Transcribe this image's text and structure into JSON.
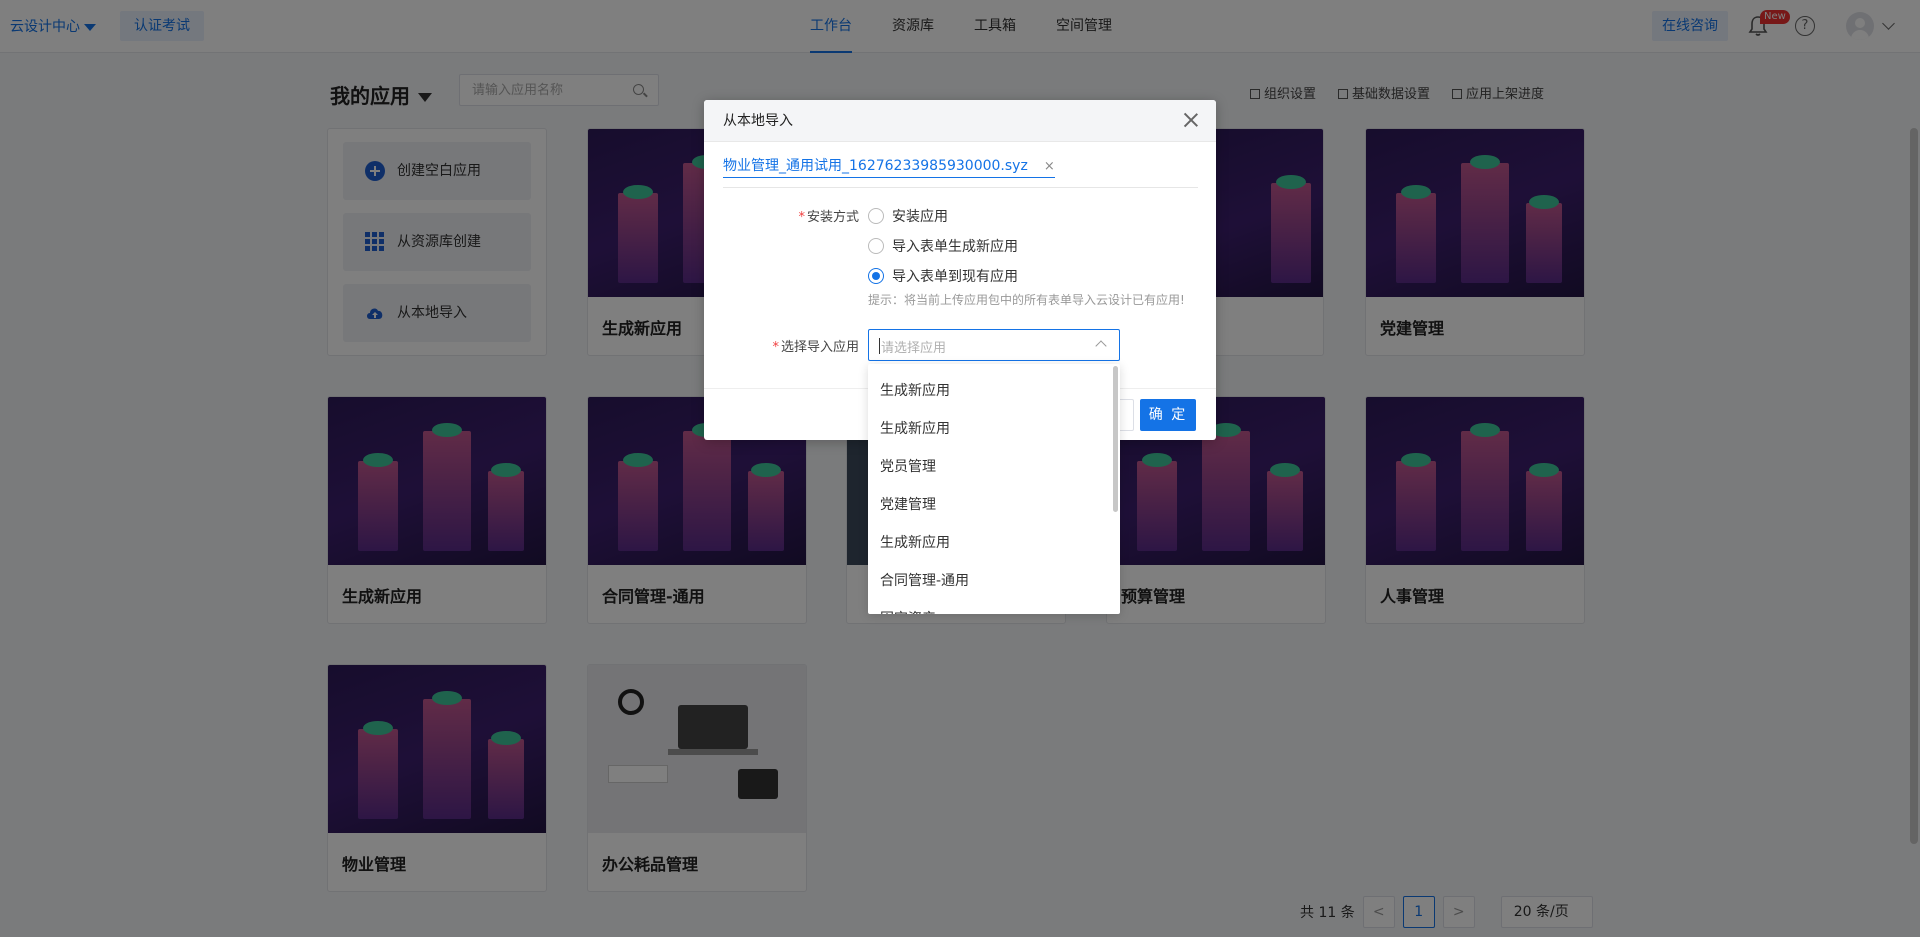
{
  "topbar": {
    "brand": "云设计中心",
    "cert": "认证考试",
    "nav": [
      "工作台",
      "资源库",
      "工具箱",
      "空间管理"
    ],
    "active_nav": "工作台",
    "consult": "在线咨询",
    "new_badge": "New",
    "help": "?"
  },
  "header": {
    "title": "我的应用",
    "search_placeholder": "请输入应用名称",
    "links": [
      "组织设置",
      "基础数据设置",
      "应用上架进度"
    ]
  },
  "create": {
    "blank": "创建空白应用",
    "from_repo": "从资源库创建",
    "from_local": "从本地导入"
  },
  "apps": [
    "生成新应用",
    "党建管理",
    "生成新应用",
    "合同管理-通用",
    "预算管理",
    "人事管理",
    "物业管理",
    "办公耗品管理"
  ],
  "pager": {
    "total": "共 11 条",
    "prev": "<",
    "page": "1",
    "next": ">",
    "size": "20 条/页"
  },
  "modal": {
    "title": "从本地导入",
    "file": "物业管理_通用试用_16276233985930000.syz",
    "file_remove": "×",
    "install_label": "安装方式",
    "options": [
      "安装应用",
      "导入表单生成新应用",
      "导入表单到现有应用"
    ],
    "selected_option": "导入表单到现有应用",
    "hint": "提示：将当前上传应用包中的所有表单导入云设计已有应用!",
    "select_label": "选择导入应用",
    "select_placeholder": "请选择应用",
    "ok": "确 定"
  },
  "dropdown": {
    "options": [
      "生成新应用",
      "生成新应用",
      "党员管理",
      "党建管理",
      "生成新应用",
      "合同管理-通用",
      "固定资产"
    ]
  },
  "colors": {
    "primary": "#1473e6",
    "required": "#f03e3e",
    "new_badge": "#ee3131"
  }
}
